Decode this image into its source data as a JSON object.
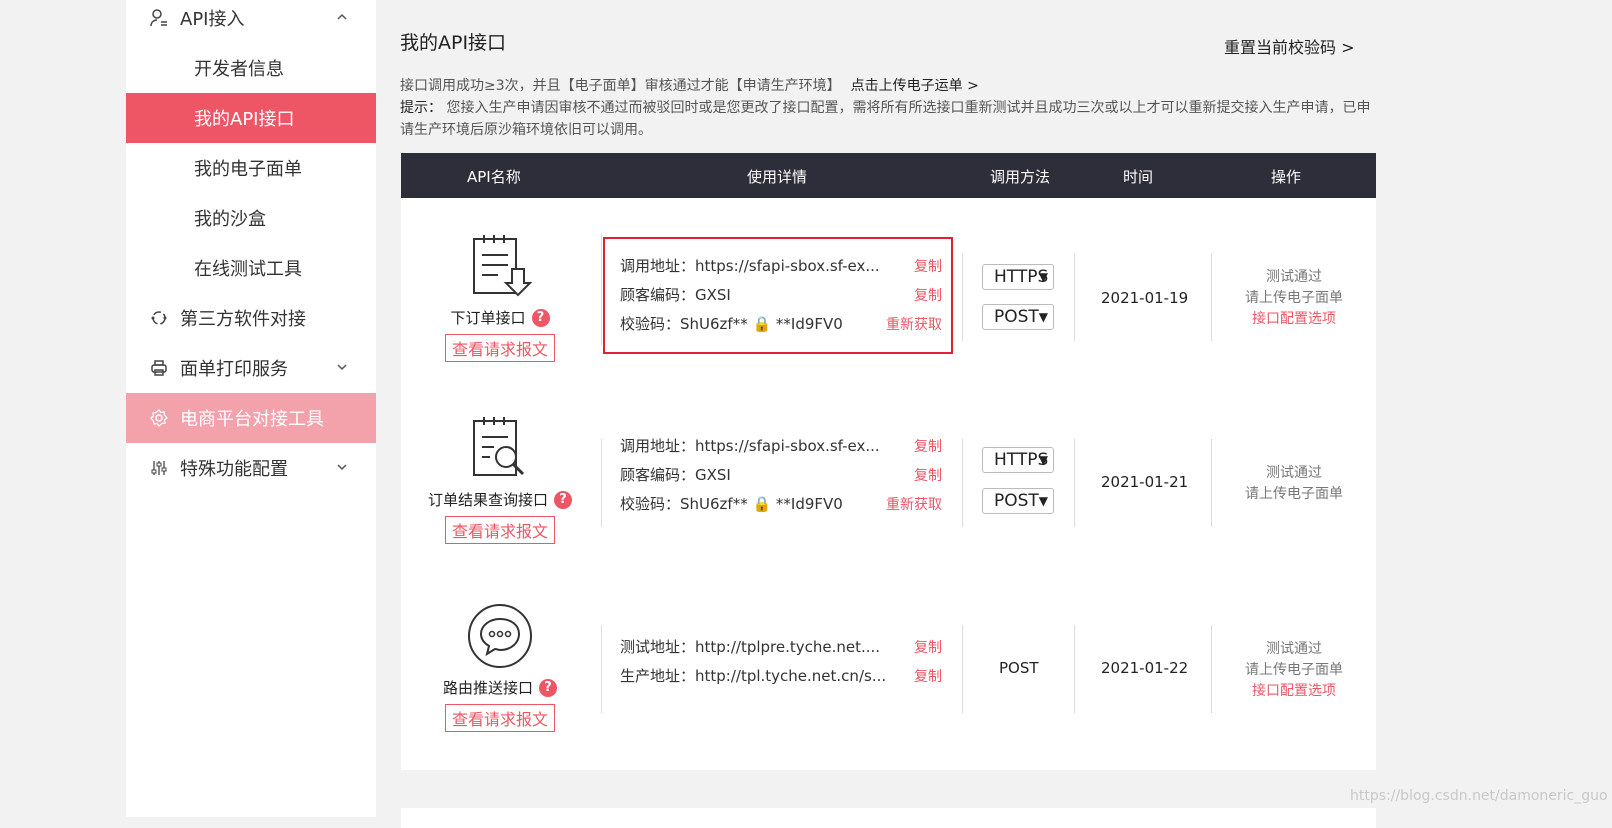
{
  "sidebar": {
    "api_access": "API接入",
    "items": [
      {
        "label": "开发者信息"
      },
      {
        "label": "我的API接口"
      },
      {
        "label": "我的电子面单"
      },
      {
        "label": "我的沙盒"
      },
      {
        "label": "在线测试工具"
      }
    ],
    "third_party": "第三方软件对接",
    "print_service": "面单打印服务",
    "ecommerce_tool": "电商平台对接工具",
    "special_config": "特殊功能配置"
  },
  "main": {
    "title": "我的API接口",
    "reset_link": "重置当前校验码 >",
    "notice_line1": "接口调用成功≥3次，并且【电子面单】审核通过才能【申请生产环境】",
    "upload_link": "点击上传电子运单 >",
    "tip_label": "提示：",
    "tip_text": " 您接入生产申请因审核不通过而被驳回时或是您更改了接口配置，需将所有所选接口重新测试并且成功三次或以上才可以重新提交接入生产申请，已申请生产环境后原沙箱环境依旧可以调用。"
  },
  "table": {
    "headers": [
      "API名称",
      "使用详情",
      "调用方法",
      "时间",
      "操作"
    ],
    "rows": [
      {
        "icon": "order-clipboard-icon",
        "name": "下订单接口",
        "view_label": "查看请求报文",
        "details": [
          {
            "text": "调用地址：https://sfapi-sbox.sf-ex...",
            "action": "复制"
          },
          {
            "text": "顾客编码：GXSI",
            "action": "复制"
          },
          {
            "text": "校验码：ShU6zf** 🔒 **Id9FV0",
            "action": "重新获取"
          }
        ],
        "protocol": "HTTPS",
        "method": "POST",
        "date": "2021-01-19",
        "status": "测试通过",
        "upload": "请上传电子面单",
        "config": "接口配置选项"
      },
      {
        "icon": "order-search-icon",
        "name": "订单结果查询接口",
        "view_label": "查看请求报文",
        "details": [
          {
            "text": "调用地址：https://sfapi-sbox.sf-ex...",
            "action": "复制"
          },
          {
            "text": "顾客编码：GXSI",
            "action": "复制"
          },
          {
            "text": "校验码：ShU6zf** 🔒 **Id9FV0",
            "action": "重新获取"
          }
        ],
        "protocol": "HTTPS",
        "method": "POST",
        "date": "2021-01-21",
        "status": "测试通过",
        "upload": "请上传电子面单"
      },
      {
        "icon": "chat-bubble-icon",
        "name": "路由推送接口",
        "view_label": "查看请求报文",
        "details": [
          {
            "text": "测试地址：http://tplpre.tyche.net....",
            "action": "复制"
          },
          {
            "text": "生产地址：http://tpl.tyche.net.cn/s...",
            "action": "复制"
          }
        ],
        "method": "POST",
        "date": "2021-01-22",
        "status": "测试通过",
        "upload": "请上传电子面单",
        "config": "接口配置选项"
      }
    ]
  },
  "watermark": "https://blog.csdn.net/damoneric_guo",
  "colors": {
    "accent": "#ee5565",
    "accent_light": "#f3a2ac",
    "header_bg": "#2e2d3a",
    "highlight_border": "#e2202f"
  }
}
